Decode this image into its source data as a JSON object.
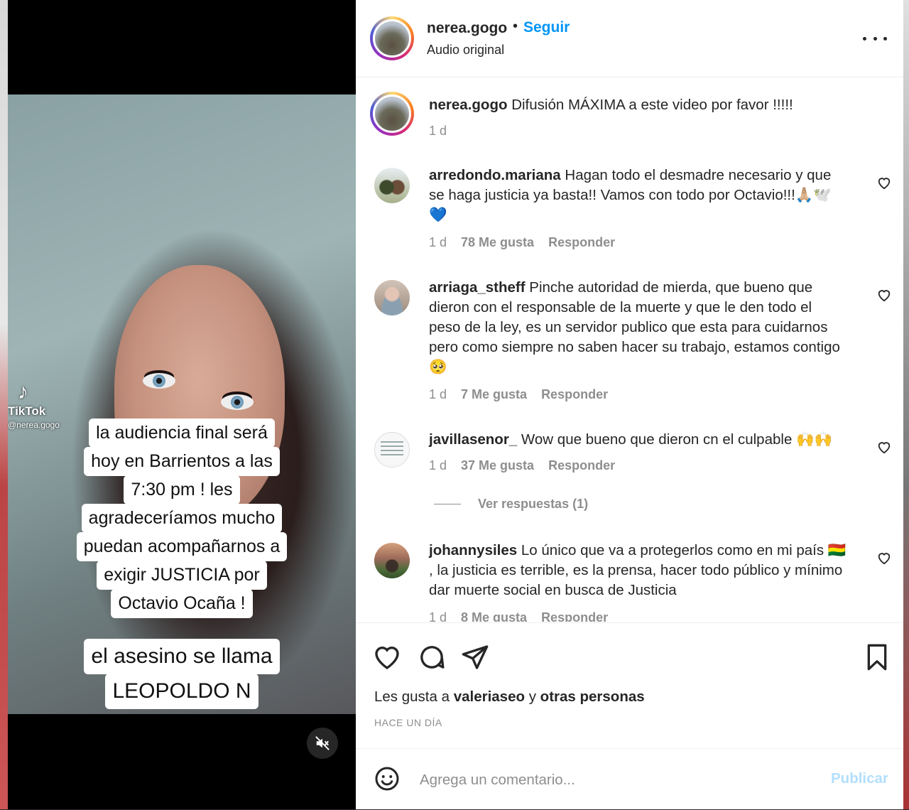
{
  "media": {
    "caption_lines": [
      "la audiencia final será",
      "hoy en Barrientos a las",
      "7:30 pm ! les",
      "agradeceríamos mucho",
      "puedan acompañarnos a",
      "exigir JUSTICIA por",
      "Octavio Ocaña !"
    ],
    "caption_lines_2": [
      "el asesino se llama",
      "LEOPOLDO N"
    ],
    "watermark_brand": "TikTok",
    "watermark_handle": "@nerea.gogo",
    "mute_icon": "muted-speaker-icon"
  },
  "header": {
    "username": "nerea.gogo",
    "separator": "•",
    "follow_label": "Seguir",
    "subtitle": "Audio original",
    "more_icon": "more-options-icon"
  },
  "caption": {
    "username": "nerea.gogo",
    "text": "Difusión MÁXIMA a este video por favor !!!!!",
    "time": "1 d"
  },
  "comments": [
    {
      "username": "arredondo.mariana",
      "text": "Hagan todo el desmadre necesario y que se haga justicia ya basta!! Vamos con todo por Octavio!!!🙏🏼🕊️💙",
      "time": "1 d",
      "likes": "78 Me gusta",
      "reply": "Responder"
    },
    {
      "username": "arriaga_stheff",
      "text": "Pinche autoridad de mierda, que bueno que dieron con el responsable de la muerte y que le den todo el peso de la ley, es un servidor publico que esta para cuidarnos pero como siempre no saben hacer su trabajo, estamos contigo 🥺",
      "time": "1 d",
      "likes": "7 Me gusta",
      "reply": "Responder"
    },
    {
      "username": "javillasenor_",
      "text": "Wow que bueno que dieron cn el culpable 🙌🙌",
      "time": "1 d",
      "likes": "37 Me gusta",
      "reply": "Responder",
      "view_replies": "Ver respuestas (1)"
    },
    {
      "username": "johannysiles",
      "text": "Lo único que va a protegerlos como en mi país 🇧🇴 , la justicia es terrible, es la prensa, hacer todo público y mínimo dar muerte social en busca de Justicia",
      "time": "1 d",
      "likes": "8 Me gusta",
      "reply": "Responder"
    }
  ],
  "actions": {
    "likes_prefix": "Les gusta a",
    "liked_by": "valeriaseo",
    "likes_mid": "y",
    "likes_others": "otras personas",
    "posted_ago": "HACE UN DÍA"
  },
  "add_comment": {
    "placeholder": "Agrega un comentario...",
    "post_label": "Publicar"
  },
  "colors": {
    "link": "#0095f6",
    "muted": "#8e8e8e",
    "text": "#262626",
    "post_disabled": "#b2dffc"
  }
}
